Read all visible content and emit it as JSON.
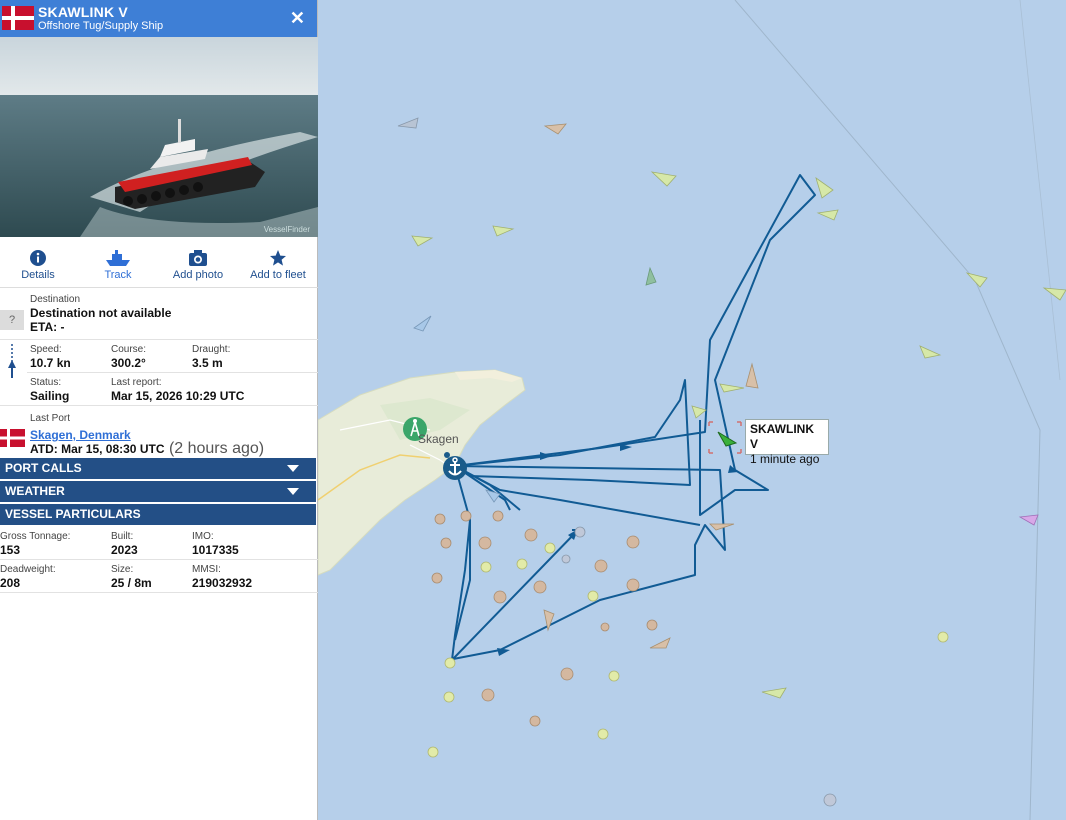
{
  "vessel": {
    "name": "SKAWLINK V",
    "type": "Offshore Tug/Supply Ship",
    "flag_colors": [
      "#c8102e",
      "#ffffff"
    ],
    "photo_watermark": "VesselFinder"
  },
  "actions": [
    {
      "label": "Details",
      "icon": "info-icon"
    },
    {
      "label": "Track",
      "icon": "ship-icon"
    },
    {
      "label": "Add photo",
      "icon": "camera-icon"
    },
    {
      "label": "Add to fleet",
      "icon": "star-icon"
    }
  ],
  "destination": {
    "label": "Destination",
    "value": "Destination not available",
    "eta_text": "ETA: -",
    "unknown_icon_text": "?"
  },
  "navigation": {
    "speed": {
      "label": "Speed:",
      "value": "10.7 kn"
    },
    "course": {
      "label": "Course:",
      "value": "300.2°"
    },
    "draught": {
      "label": "Draught:",
      "value": "3.5 m"
    },
    "status": {
      "label": "Status:",
      "value": "Sailing"
    },
    "last_report": {
      "label": "Last report:",
      "value": "Mar 15, 2026 10:29 UTC"
    }
  },
  "last_port": {
    "label": "Last Port",
    "name": "Skagen, Denmark",
    "atd": "ATD: Mar 15, 08:30 UTC",
    "ago": "(2 hours ago)"
  },
  "sections": {
    "port_calls": "PORT CALLS",
    "weather": "WEATHER",
    "particulars": "VESSEL PARTICULARS"
  },
  "particulars": {
    "gross_tonnage": {
      "label": "Gross Tonnage:",
      "value": "153"
    },
    "built": {
      "label": "Built:",
      "value": "2023"
    },
    "imo": {
      "label": "IMO:",
      "value": "1017335"
    },
    "deadweight": {
      "label": "Deadweight:",
      "value": "208"
    },
    "size": {
      "label": "Size:",
      "value": "25 / 8m"
    },
    "mmsi": {
      "label": "MMSI:",
      "value": "219032932"
    }
  },
  "map": {
    "town_label": "Skagen",
    "popup_name": "SKAWLINK V",
    "popup_time": "1 minute ago",
    "colors": {
      "sea": "#b6cfea",
      "land": "#e8ecd9",
      "track": "#115b94",
      "port": "#1a5b8a"
    }
  }
}
